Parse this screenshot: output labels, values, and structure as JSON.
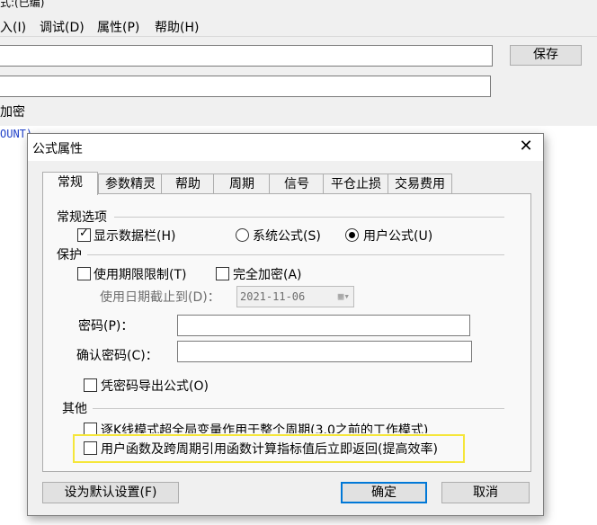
{
  "app": {
    "title_fragment": "式:(已编)",
    "menu": [
      "入(I)",
      "调试(D)",
      "属性(P)",
      "帮助(H)"
    ],
    "save_label": "保存",
    "encrypt_label": "加密",
    "code_fragment": "OUNT)"
  },
  "dialog": {
    "title": "公式属性",
    "close_glyph": "✕",
    "tabs": [
      "常规",
      "参数精灵",
      "帮助",
      "周期",
      "信号",
      "平仓止损",
      "交易费用"
    ],
    "active_tab": "常规",
    "general": {
      "group_label": "常规选项",
      "show_data_bar": {
        "label": "显示数据栏(H)",
        "checked": true
      },
      "system_formula": {
        "label": "系统公式(S)",
        "selected": false
      },
      "user_formula": {
        "label": "用户公式(U)",
        "selected": true
      }
    },
    "protect": {
      "group_label": "保护",
      "use_period_limit": {
        "label": "使用期限限制(T)",
        "checked": false
      },
      "full_encrypt": {
        "label": "完全加密(A)",
        "checked": false
      },
      "expiry_label": "使用日期截止到(D)：",
      "expiry_date": "2021-11-06",
      "password_label": "密码(P)：",
      "password_value": "",
      "confirm_password_label": "确认密码(C)：",
      "confirm_password_value": "",
      "export_with_password": {
        "label": "凭密码导出公式(O)",
        "checked": false
      }
    },
    "other": {
      "group_label": "其他",
      "option1": {
        "label": "逐K线模式超全局变量作用于整个周期(3.0之前的工作模式)",
        "checked": false
      },
      "option2": {
        "label": "用户函数及跨周期引用函数计算指标值后立即返回(提高效率)",
        "checked": false
      }
    },
    "buttons": {
      "set_default": "设为默认设置(F)",
      "ok": "确定",
      "cancel": "取消"
    },
    "highlight_color": "#f5e63a"
  }
}
